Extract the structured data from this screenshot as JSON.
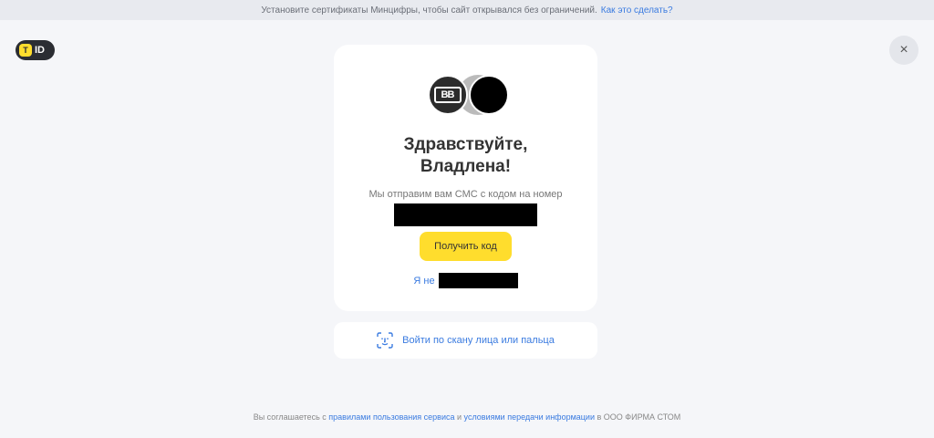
{
  "banner": {
    "text": "Установите сертификаты Минцифры, чтобы сайт открывался без ограничений.",
    "link": "Как это сделать?"
  },
  "logo": {
    "mark": "T",
    "text": "ID"
  },
  "close": {
    "label": "×"
  },
  "card": {
    "avatar_monogram": "BB",
    "greeting_line1": "Здравствуйте,",
    "greeting_line2": "Владлена!",
    "hint": "Мы отправим вам СМС с кодом на номер",
    "get_code_label": "Получить код",
    "not_me_label": "Я не"
  },
  "face_login": {
    "label": "Войти по скану лица или пальца",
    "icon": "face-scan-icon"
  },
  "footer": {
    "prefix": "Вы соглашаетесь с",
    "link1": "правилами пользования сервиса",
    "middle": "и",
    "link2": "условиями передачи информации",
    "suffix": "в ООО ФИРМА СТОМ"
  },
  "colors": {
    "accent": "#ffdd2d",
    "link": "#3a7be0",
    "background": "#f5f6f9"
  }
}
